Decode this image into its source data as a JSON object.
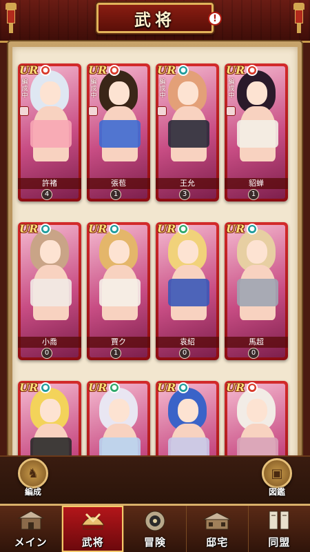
{
  "header": {
    "title": "武将",
    "info_badge": "!"
  },
  "cards": [
    {
      "rarity": "UR",
      "name": "許褚",
      "level": "4",
      "formed": "編成中",
      "type": "red",
      "hair": "#dfe7f2",
      "cloth": "#f7a6b4"
    },
    {
      "rarity": "UR",
      "name": "張苞",
      "level": "1",
      "formed": "編成中",
      "type": "red",
      "hair": "#3a2618",
      "cloth": "#3e6ad1"
    },
    {
      "rarity": "UR",
      "name": "王允",
      "level": "3",
      "formed": "編成中",
      "type": "teal",
      "hair": "#e3a078",
      "cloth": "#2a2a3a"
    },
    {
      "rarity": "UR",
      "name": "貂蝉",
      "level": "1",
      "formed": "編成中",
      "type": "red",
      "hair": "#2a1a2a",
      "cloth": "#f3eee6"
    },
    {
      "rarity": "UR",
      "name": "小喬",
      "level": "0",
      "formed": "",
      "type": "teal",
      "hair": "#c9a487",
      "cloth": "#f1e9e4"
    },
    {
      "rarity": "UR",
      "name": "賈ク",
      "level": "1",
      "formed": "",
      "type": "teal",
      "hair": "#e4b66a",
      "cloth": "#f5f0e8"
    },
    {
      "rarity": "UR",
      "name": "袁紹",
      "level": "0",
      "formed": "",
      "type": "green",
      "hair": "#f1d27a",
      "cloth": "#3a58b8"
    },
    {
      "rarity": "UR",
      "name": "馬超",
      "level": "0",
      "formed": "",
      "type": "teal",
      "hair": "#e7cfa2",
      "cloth": "#9ea5b3"
    },
    {
      "rarity": "UR",
      "name": "",
      "level": "",
      "formed": "",
      "type": "teal",
      "hair": "#f3d35a",
      "cloth": "#2a2a2a"
    },
    {
      "rarity": "UR",
      "name": "",
      "level": "",
      "formed": "",
      "type": "green",
      "hair": "#e9e6f2",
      "cloth": "#b8d3ef"
    },
    {
      "rarity": "UR",
      "name": "",
      "level": "",
      "formed": "",
      "type": "teal",
      "hair": "#3a63c8",
      "cloth": "#c8c8e8"
    },
    {
      "rarity": "UR",
      "name": "",
      "level": "",
      "formed": "",
      "type": "red",
      "hair": "#f2ece6",
      "cloth": "#d8a2b8"
    }
  ],
  "actions": {
    "formation_label": "編成",
    "encyclopedia_label": "図鑑"
  },
  "nav": [
    {
      "label": "メイン",
      "icon": "castle-gate-icon",
      "active": false
    },
    {
      "label": "武将",
      "icon": "samurai-helmet-icon",
      "active": true
    },
    {
      "label": "冒険",
      "icon": "compass-icon",
      "active": false
    },
    {
      "label": "邸宅",
      "icon": "mansion-icon",
      "active": false
    },
    {
      "label": "同盟",
      "icon": "alliance-banner-icon",
      "active": false
    }
  ]
}
